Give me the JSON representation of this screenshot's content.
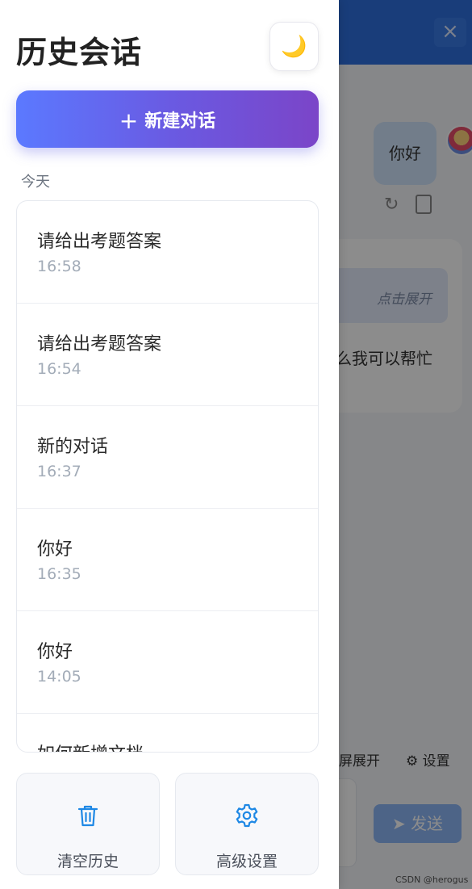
{
  "background": {
    "bubble_text": "你好",
    "expand_label": "点击展开",
    "answer_text": "么我可以帮忙",
    "fullscreen_label": "屏展开",
    "settings_label": "设置",
    "send_label": "发送",
    "watermark": "CSDN @herogus丶",
    "close_glyph": "×"
  },
  "drawer": {
    "title": "历史会话",
    "theme_icon": "🌙",
    "new_chat_label": "新建对话",
    "date_group": "今天",
    "conversations": [
      {
        "title": "请给出考题答案",
        "time": "16:58"
      },
      {
        "title": "请给出考题答案",
        "time": "16:54"
      },
      {
        "title": "新的对话",
        "time": "16:37"
      },
      {
        "title": "你好",
        "time": "16:35"
      },
      {
        "title": "你好",
        "time": "14:05"
      },
      {
        "title": "如何新增文档",
        "time": ""
      }
    ],
    "clear_label": "清空历史",
    "advanced_label": "高级设置"
  },
  "colors": {
    "accent_start": "#5b79ff",
    "accent_end": "#7b45c8",
    "icon_blue": "#1e88e5",
    "topbar_blue": "#2f6fdf"
  }
}
